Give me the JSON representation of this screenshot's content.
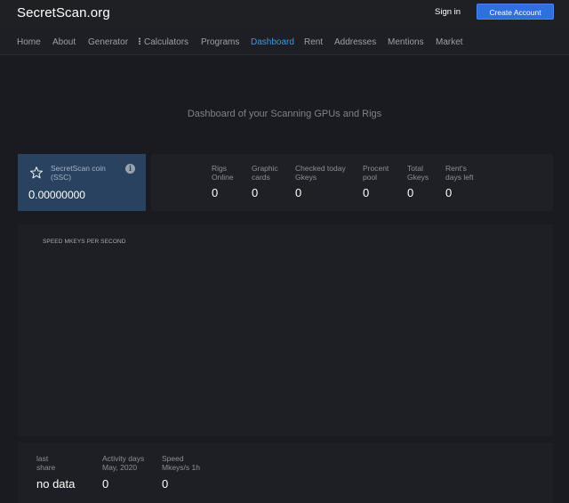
{
  "header": {
    "logo": "SecretScan.org",
    "sign_in": "Sign in",
    "create_account": "Create Account"
  },
  "nav": {
    "items": [
      {
        "label": "Home",
        "active": false
      },
      {
        "label": "About",
        "active": false
      },
      {
        "label": "Generator",
        "active": false
      },
      {
        "label": "Calculators",
        "active": false,
        "icon": "kebab-menu-icon"
      },
      {
        "label": "Programs",
        "active": false
      },
      {
        "label": "Dashboard",
        "active": true
      },
      {
        "label": "Rent",
        "active": false
      },
      {
        "label": "Addresses",
        "active": false
      },
      {
        "label": "Mentions",
        "active": false
      },
      {
        "label": "Market",
        "active": false
      }
    ]
  },
  "page": {
    "heading": "Dashboard of your Scanning GPUs and Rigs"
  },
  "coin": {
    "label_line1": "SecretScan coin",
    "label_line2": "(SSC)",
    "value_int": "0",
    "value_frac": ".00000000",
    "icons": [
      "star-icon",
      "info-icon"
    ]
  },
  "stats": [
    {
      "label": "Rigs\nOnline",
      "value": "0"
    },
    {
      "label": "Graphic\ncards",
      "value": "0"
    },
    {
      "label": "Checked today\nGkeys",
      "value": "0"
    },
    {
      "label": "Procent\npool",
      "value": "0"
    },
    {
      "label": "Total\nGkeys",
      "value": "0"
    },
    {
      "label": "Rent's\ndays left",
      "value": "0"
    }
  ],
  "speed_panel": {
    "title": "SPEED MKEYS PER SECOND"
  },
  "bottom": [
    {
      "label": "last\nshare",
      "value": "no data"
    },
    {
      "label": "Activity days\nMay, 2020",
      "value": "0"
    },
    {
      "label": "Speed\nMkeys/s 1h",
      "value": "0"
    }
  ],
  "colors": {
    "accent": "#3d97e0",
    "button": "#2f6fe0",
    "coin_card": "#29425f",
    "background": "#1a1b20"
  }
}
